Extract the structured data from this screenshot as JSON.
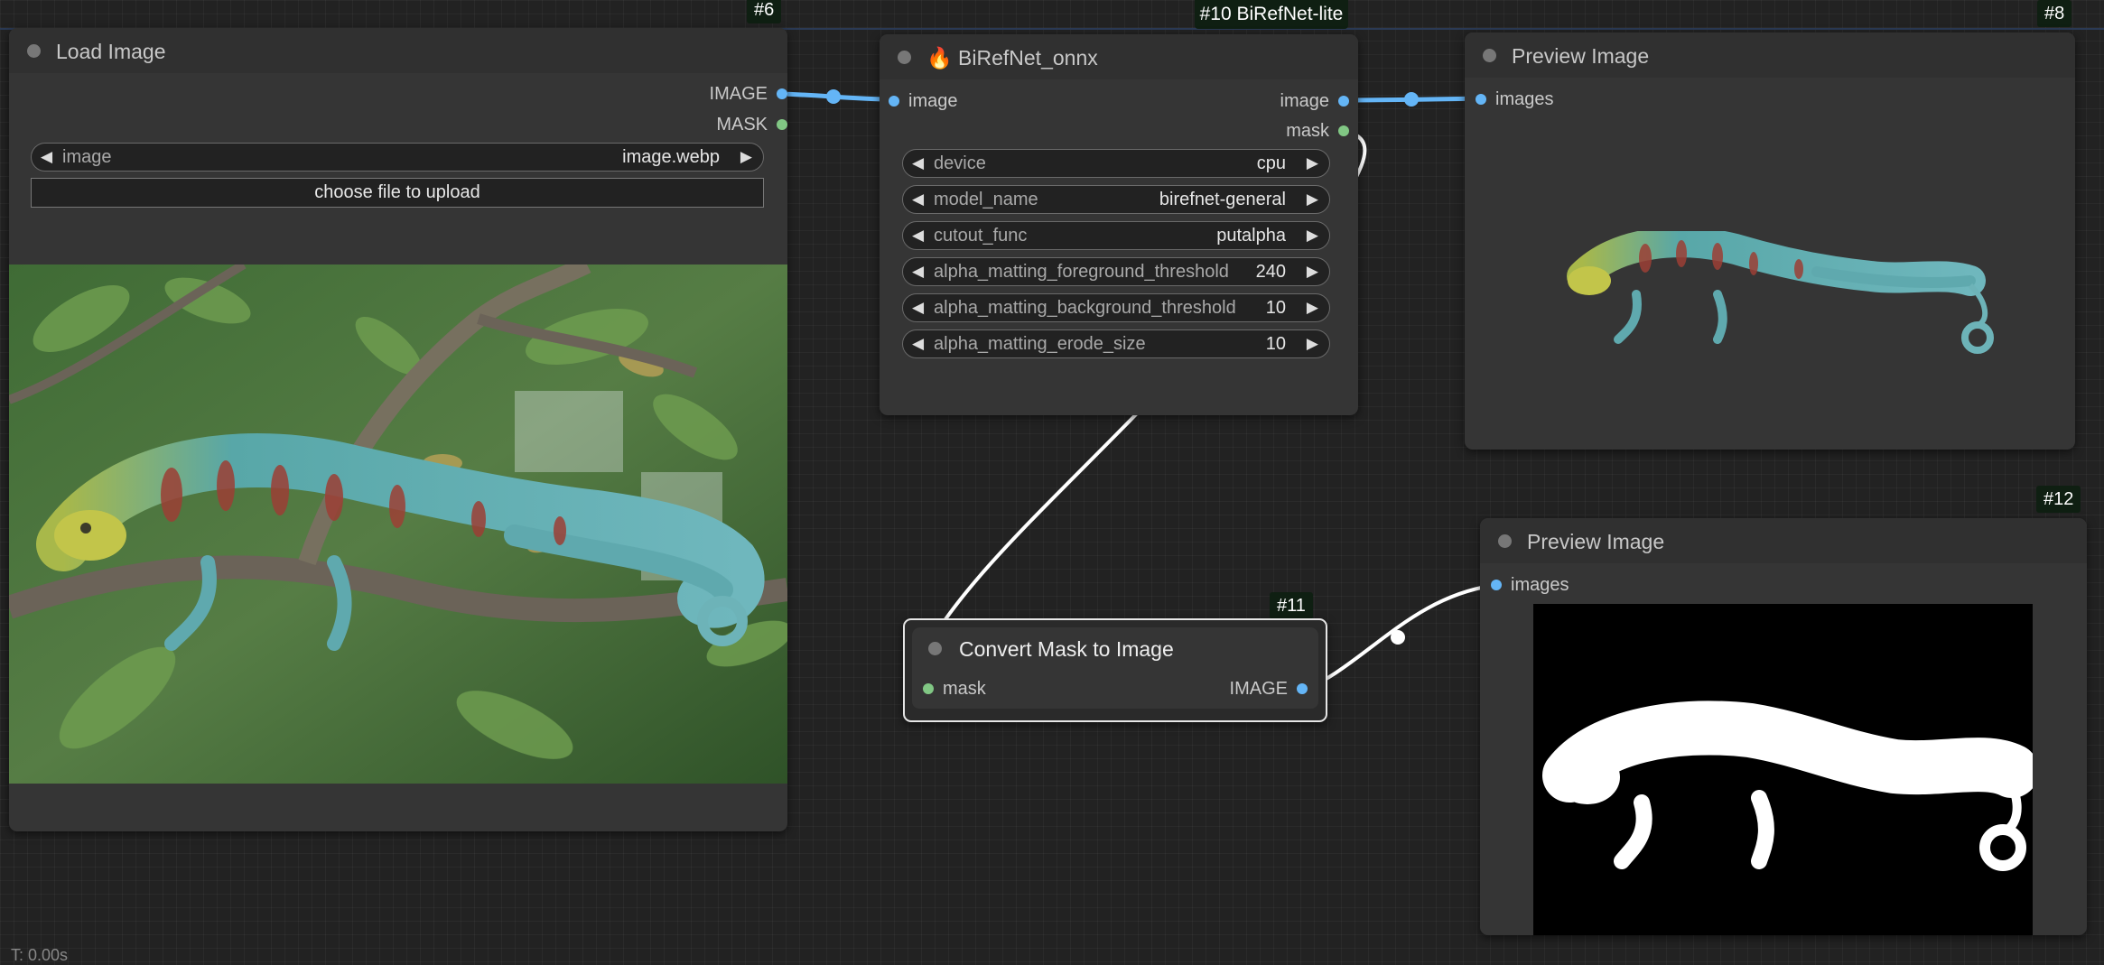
{
  "group": {
    "title": "#10 BiRefNet-lite"
  },
  "nodes": {
    "load_image": {
      "id": "#6",
      "title": "Load Image",
      "outputs": [
        "IMAGE",
        "MASK"
      ],
      "widget": {
        "label": "image",
        "value": "image.webp"
      },
      "upload_button": "choose file to upload"
    },
    "birefnet": {
      "title": "BiRefNet_onnx",
      "icon": "🔥",
      "input": "image",
      "outputs": [
        "image",
        "mask"
      ],
      "widgets": [
        {
          "label": "device",
          "value": "cpu"
        },
        {
          "label": "model_name",
          "value": "birefnet-general"
        },
        {
          "label": "cutout_func",
          "value": "putalpha"
        },
        {
          "label": "alpha_matting_foreground_threshold",
          "value": "240"
        },
        {
          "label": "alpha_matting_background_threshold",
          "value": "10"
        },
        {
          "label": "alpha_matting_erode_size",
          "value": "10"
        }
      ]
    },
    "preview_8": {
      "id": "#8",
      "title": "Preview Image",
      "input": "images"
    },
    "convert_mask": {
      "id": "#11",
      "title": "Convert Mask to Image",
      "input": "mask",
      "output": "IMAGE"
    },
    "preview_12": {
      "id": "#12",
      "title": "Preview Image",
      "input": "images"
    }
  },
  "status": {
    "timer": "T: 0.00s"
  },
  "colors": {
    "image_link": "#64b5f6",
    "mask_link": "#81c784",
    "background": "#222222",
    "node": "#353535"
  }
}
